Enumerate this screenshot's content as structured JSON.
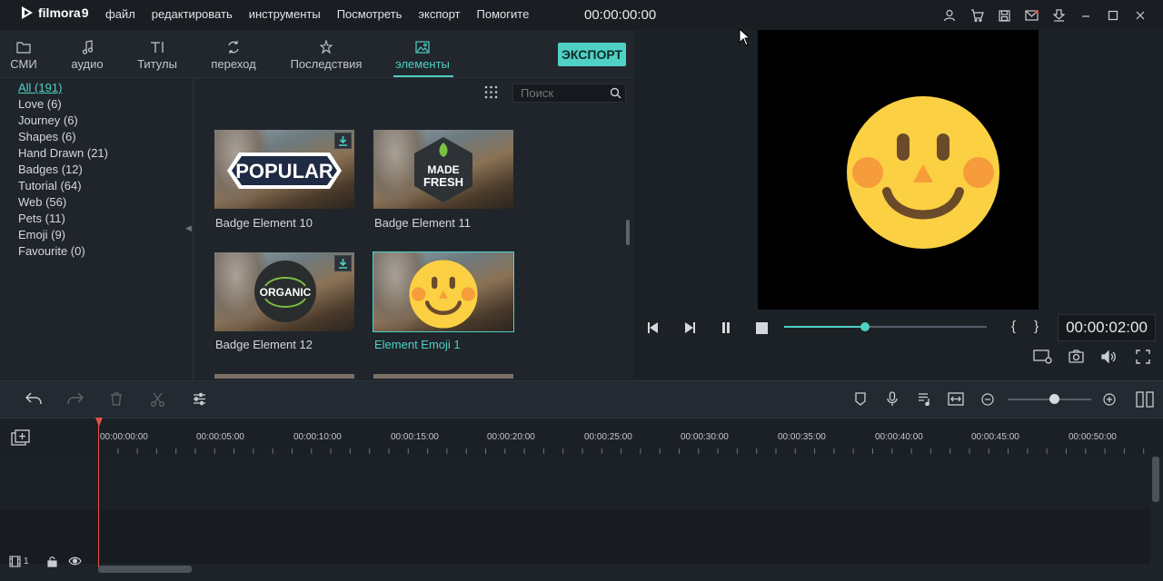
{
  "app": {
    "name": "filmora",
    "version": "9"
  },
  "menu": [
    "файл",
    "редактировать",
    "инструменты",
    "Посмотреть",
    "экспорт",
    "Помогите"
  ],
  "timecode_top": "00:00:00:00",
  "top_icons": [
    "user-icon",
    "cart-icon",
    "save-icon",
    "mail-icon",
    "download-icon",
    "minimize-icon",
    "maximize-icon",
    "close-icon"
  ],
  "tabs": [
    {
      "label": "СМИ",
      "icon": "folder-icon"
    },
    {
      "label": "аудио",
      "icon": "music-note-icon"
    },
    {
      "label": "Титулы",
      "icon": "text-icon"
    },
    {
      "label": "переход",
      "icon": "transition-icon"
    },
    {
      "label": "Последствия",
      "icon": "effects-icon"
    },
    {
      "label": "элементы",
      "icon": "image-icon",
      "active": true
    }
  ],
  "export_label": "ЭКСПОРТ",
  "categories": [
    "All (191)",
    "Love (6)",
    "Journey (6)",
    "Shapes (6)",
    "Hand Drawn (21)",
    "Badges (12)",
    "Tutorial (64)",
    "Web (56)",
    "Pets (11)",
    "Emoji (9)",
    "Favourite (0)"
  ],
  "active_category": 0,
  "search": {
    "placeholder": "Поиск"
  },
  "thumbnails": [
    {
      "label": "Badge Element 10",
      "badge": "POPULAR",
      "downloadable": true
    },
    {
      "label": "Badge Element 11",
      "badge": "MADE FRESH",
      "downloadable": false
    },
    {
      "label": "Badge Element 12",
      "badge": "ORGANIC",
      "downloadable": true
    },
    {
      "label": "Element Emoji 1",
      "badge": "emoji",
      "downloadable": false,
      "selected": true
    }
  ],
  "player": {
    "time": "00:00:02:00",
    "brackets": "{ }",
    "progress": 0.4
  },
  "timeline": {
    "ticks": [
      "00:00:00:00",
      "00:00:05:00",
      "00:00:10:00",
      "00:00:15:00",
      "00:00:20:00",
      "00:00:25:00",
      "00:00:30:00",
      "00:00:35:00",
      "00:00:40:00",
      "00:00:45:00",
      "00:00:50:00"
    ],
    "track_number": "1",
    "zoom": 0.55
  },
  "colors": {
    "accent": "#4fd1c5",
    "playhead": "#e0534a",
    "emoji": "#fbd043"
  }
}
